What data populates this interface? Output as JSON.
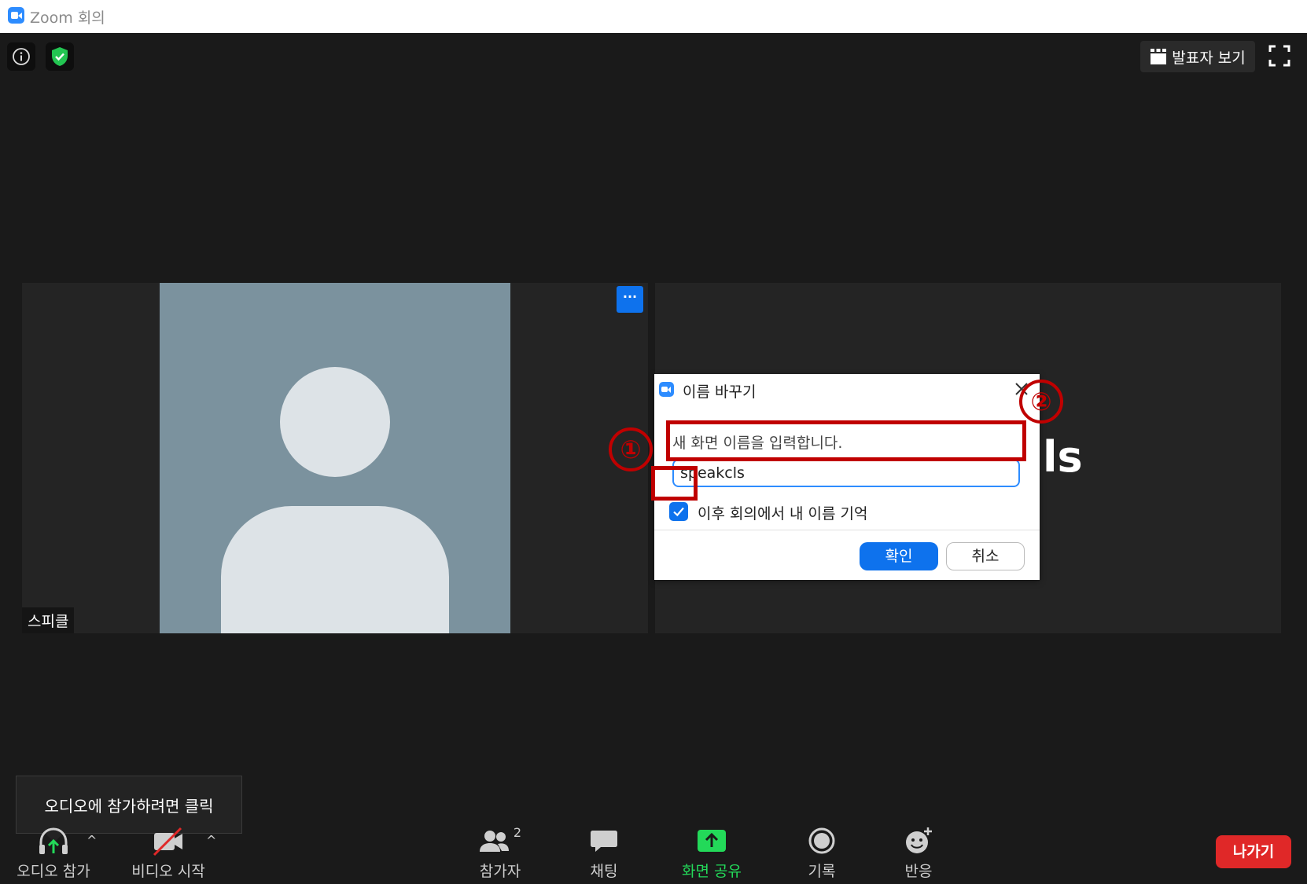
{
  "window": {
    "title": "Zoom 회의"
  },
  "top_bar": {
    "view_label": "발표자 보기"
  },
  "participant_tile": {
    "name": "스피클",
    "more_label": "···"
  },
  "right_tile": {
    "partial_text": "ls"
  },
  "dialog": {
    "title": "이름 바꾸기",
    "prompt": "새 화면 이름을 입력합니다.",
    "input_value": "speakcls",
    "checkbox_label": "이후 회의에서 내 이름 기억",
    "checkbox_checked": true,
    "ok_label": "확인",
    "cancel_label": "취소"
  },
  "annotations": {
    "marker_1": "①",
    "marker_2": "②",
    "color": "#c00000"
  },
  "tooltip": {
    "text": "오디오에 참가하려면 클릭"
  },
  "toolbar": {
    "audio_label": "오디오 참가",
    "video_label": "비디오 시작",
    "participants_label": "참가자",
    "participants_count": "2",
    "chat_label": "채팅",
    "share_label": "화면 공유",
    "record_label": "기록",
    "reactions_label": "반응",
    "leave_label": "나가기"
  },
  "colors": {
    "accent": "#0e72ed",
    "share_green": "#23d959",
    "leave_red": "#e02828",
    "shield_green": "#23c552"
  }
}
